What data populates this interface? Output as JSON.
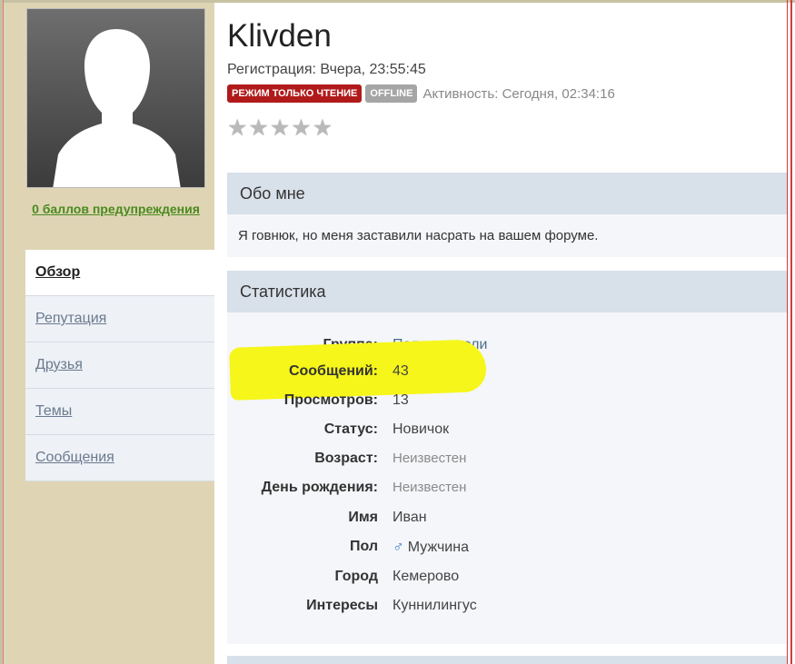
{
  "profile": {
    "username": "Klivden",
    "registration": "Регистрация: Вчера, 23:55:45",
    "badge_readonly": "РЕЖИМ ТОЛЬКО ЧТЕНИЕ",
    "badge_offline": "OFFLINE",
    "activity": "Активность: Сегодня, 02:34:16",
    "rating_stars": 0,
    "rating_max": 5
  },
  "sidebar": {
    "warnings": "0 баллов предупреждения",
    "nav": [
      {
        "label": "Обзор",
        "active": true
      },
      {
        "label": "Репутация",
        "active": false
      },
      {
        "label": "Друзья",
        "active": false
      },
      {
        "label": "Темы",
        "active": false
      },
      {
        "label": "Сообщения",
        "active": false
      }
    ]
  },
  "about": {
    "heading": "Обо мне",
    "text": "Я говнюк, но меня заставили насрать на вашем форуме."
  },
  "stats": {
    "heading": "Статистика",
    "rows": [
      {
        "label": "Группа:",
        "value": "Пользователи"
      },
      {
        "label": "Сообщений:",
        "value": "43"
      },
      {
        "label": "Просмотров:",
        "value": "13"
      },
      {
        "label": "Статус:",
        "value": "Новичок"
      },
      {
        "label": "Возраст:",
        "value": "Неизвестен"
      },
      {
        "label": "День рождения:",
        "value": "Неизвестен"
      },
      {
        "label": "Имя",
        "value": "Иван"
      },
      {
        "label": "Пол",
        "value": "Мужчина"
      },
      {
        "label": "Город",
        "value": "Кемерово"
      },
      {
        "label": "Интересы",
        "value": "Куннилингус"
      }
    ]
  },
  "colors": {
    "sidebar_bg": "#dfd5b4",
    "badge_readonly": "#b11a1a",
    "badge_offline": "#a5a5a5",
    "section_head": "#d8e0ea",
    "highlight": "#f6f61a"
  }
}
